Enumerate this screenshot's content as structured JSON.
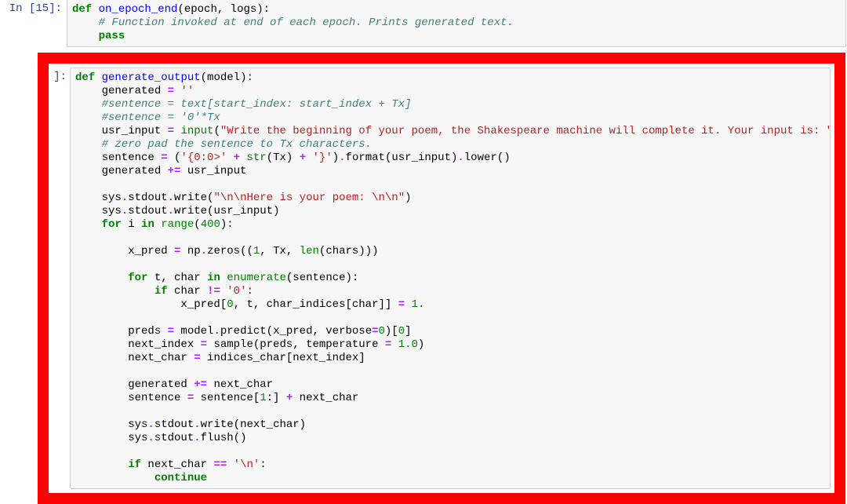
{
  "cell1": {
    "prompt": "In [15]:",
    "lines": [
      {
        "segs": [
          [
            "kw",
            "def"
          ],
          [
            "",
            " "
          ],
          [
            "def",
            "on_epoch_end"
          ],
          [
            "",
            "(epoch, logs):"
          ]
        ]
      },
      {
        "segs": [
          [
            "",
            "    "
          ],
          [
            "cm",
            "# Function invoked at end of each epoch. Prints generated text."
          ]
        ]
      },
      {
        "segs": [
          [
            "",
            "    "
          ],
          [
            "kw",
            "pass"
          ]
        ]
      }
    ]
  },
  "cell2": {
    "prompt": "]:",
    "lines": [
      {
        "segs": [
          [
            "kw",
            "def"
          ],
          [
            "",
            " "
          ],
          [
            "def",
            "generate_output"
          ],
          [
            "",
            "(model):"
          ]
        ]
      },
      {
        "segs": [
          [
            "",
            "    generated "
          ],
          [
            "op",
            "="
          ],
          [
            "",
            " "
          ],
          [
            "str",
            "''"
          ]
        ]
      },
      {
        "segs": [
          [
            "",
            "    "
          ],
          [
            "cm",
            "#sentence = text[start_index: start_index + Tx]"
          ]
        ]
      },
      {
        "segs": [
          [
            "",
            "    "
          ],
          [
            "cm",
            "#sentence = '0'*Tx"
          ]
        ]
      },
      {
        "segs": [
          [
            "",
            "    usr_input "
          ],
          [
            "op",
            "="
          ],
          [
            "",
            " "
          ],
          [
            "bi",
            "input"
          ],
          [
            "",
            "("
          ],
          [
            "str",
            "\"Write the beginning of your poem, the Shakespeare machine will complete it. Your input is: \""
          ],
          [
            "",
            ")"
          ]
        ]
      },
      {
        "segs": [
          [
            "",
            "    "
          ],
          [
            "cm",
            "# zero pad the sentence to Tx characters."
          ]
        ]
      },
      {
        "segs": [
          [
            "",
            "    sentence "
          ],
          [
            "op",
            "="
          ],
          [
            "",
            " ("
          ],
          [
            "str",
            "'{0:0>'"
          ],
          [
            "",
            " "
          ],
          [
            "op",
            "+"
          ],
          [
            "",
            " "
          ],
          [
            "bi",
            "str"
          ],
          [
            "",
            "(Tx) "
          ],
          [
            "op",
            "+"
          ],
          [
            "",
            " "
          ],
          [
            "str",
            "'}'"
          ],
          [
            "",
            ")"
          ],
          [
            "op",
            "."
          ],
          [
            "",
            "format(usr_input)"
          ],
          [
            "op",
            "."
          ],
          [
            "",
            "lower()"
          ]
        ]
      },
      {
        "segs": [
          [
            "",
            "    generated "
          ],
          [
            "op",
            "+="
          ],
          [
            "",
            " usr_input"
          ]
        ]
      },
      {
        "segs": [
          [
            "",
            ""
          ]
        ]
      },
      {
        "segs": [
          [
            "",
            "    sys"
          ],
          [
            "op",
            "."
          ],
          [
            "",
            "stdout"
          ],
          [
            "op",
            "."
          ],
          [
            "",
            "write("
          ],
          [
            "str",
            "\"\\n\\nHere is your poem: \\n\\n\""
          ],
          [
            "",
            ")"
          ]
        ]
      },
      {
        "segs": [
          [
            "",
            "    sys"
          ],
          [
            "op",
            "."
          ],
          [
            "",
            "stdout"
          ],
          [
            "op",
            "."
          ],
          [
            "",
            "write(usr_input)"
          ]
        ]
      },
      {
        "segs": [
          [
            "",
            "    "
          ],
          [
            "kw",
            "for"
          ],
          [
            "",
            " i "
          ],
          [
            "kw",
            "in"
          ],
          [
            "",
            " "
          ],
          [
            "bi",
            "range"
          ],
          [
            "",
            "("
          ],
          [
            "num",
            "400"
          ],
          [
            "",
            "):"
          ]
        ]
      },
      {
        "segs": [
          [
            "",
            ""
          ]
        ]
      },
      {
        "segs": [
          [
            "",
            "        x_pred "
          ],
          [
            "op",
            "="
          ],
          [
            "",
            " np"
          ],
          [
            "op",
            "."
          ],
          [
            "",
            "zeros(("
          ],
          [
            "num",
            "1"
          ],
          [
            "",
            ", Tx, "
          ],
          [
            "bi",
            "len"
          ],
          [
            "",
            "(chars)))"
          ]
        ]
      },
      {
        "segs": [
          [
            "",
            ""
          ]
        ]
      },
      {
        "segs": [
          [
            "",
            "        "
          ],
          [
            "kw",
            "for"
          ],
          [
            "",
            " t, char "
          ],
          [
            "kw",
            "in"
          ],
          [
            "",
            " "
          ],
          [
            "bi",
            "enumerate"
          ],
          [
            "",
            "(sentence):"
          ]
        ]
      },
      {
        "segs": [
          [
            "",
            "            "
          ],
          [
            "kw",
            "if"
          ],
          [
            "",
            " char "
          ],
          [
            "op",
            "!="
          ],
          [
            "",
            " "
          ],
          [
            "str",
            "'0'"
          ],
          [
            "",
            ":"
          ]
        ]
      },
      {
        "segs": [
          [
            "",
            "                x_pred["
          ],
          [
            "num",
            "0"
          ],
          [
            "",
            ", t, char_indices[char]] "
          ],
          [
            "op",
            "="
          ],
          [
            "",
            " "
          ],
          [
            "num",
            "1."
          ]
        ]
      },
      {
        "segs": [
          [
            "",
            ""
          ]
        ]
      },
      {
        "segs": [
          [
            "",
            "        preds "
          ],
          [
            "op",
            "="
          ],
          [
            "",
            " model"
          ],
          [
            "op",
            "."
          ],
          [
            "",
            "predict(x_pred, verbose"
          ],
          [
            "op",
            "="
          ],
          [
            "num",
            "0"
          ],
          [
            "",
            ")["
          ],
          [
            "num",
            "0"
          ],
          [
            "",
            "]"
          ]
        ]
      },
      {
        "segs": [
          [
            "",
            "        next_index "
          ],
          [
            "op",
            "="
          ],
          [
            "",
            " sample(preds, temperature "
          ],
          [
            "op",
            "="
          ],
          [
            "",
            " "
          ],
          [
            "num",
            "1.0"
          ],
          [
            "",
            ")"
          ]
        ]
      },
      {
        "segs": [
          [
            "",
            "        next_char "
          ],
          [
            "op",
            "="
          ],
          [
            "",
            " indices_char[next_index]"
          ]
        ]
      },
      {
        "segs": [
          [
            "",
            ""
          ]
        ]
      },
      {
        "segs": [
          [
            "",
            "        generated "
          ],
          [
            "op",
            "+="
          ],
          [
            "",
            " next_char"
          ]
        ]
      },
      {
        "segs": [
          [
            "",
            "        sentence "
          ],
          [
            "op",
            "="
          ],
          [
            "",
            " sentence["
          ],
          [
            "num",
            "1"
          ],
          [
            "",
            ":] "
          ],
          [
            "op",
            "+"
          ],
          [
            "",
            " next_char"
          ]
        ]
      },
      {
        "segs": [
          [
            "",
            ""
          ]
        ]
      },
      {
        "segs": [
          [
            "",
            "        sys"
          ],
          [
            "op",
            "."
          ],
          [
            "",
            "stdout"
          ],
          [
            "op",
            "."
          ],
          [
            "",
            "write(next_char)"
          ]
        ]
      },
      {
        "segs": [
          [
            "",
            "        sys"
          ],
          [
            "op",
            "."
          ],
          [
            "",
            "stdout"
          ],
          [
            "op",
            "."
          ],
          [
            "",
            "flush()"
          ]
        ]
      },
      {
        "segs": [
          [
            "",
            ""
          ]
        ]
      },
      {
        "segs": [
          [
            "",
            "        "
          ],
          [
            "kw",
            "if"
          ],
          [
            "",
            " next_char "
          ],
          [
            "op",
            "=="
          ],
          [
            "",
            " "
          ],
          [
            "str",
            "'\\n'"
          ],
          [
            "",
            ":"
          ]
        ]
      },
      {
        "segs": [
          [
            "",
            "            "
          ],
          [
            "kw",
            "continue"
          ]
        ]
      }
    ]
  }
}
